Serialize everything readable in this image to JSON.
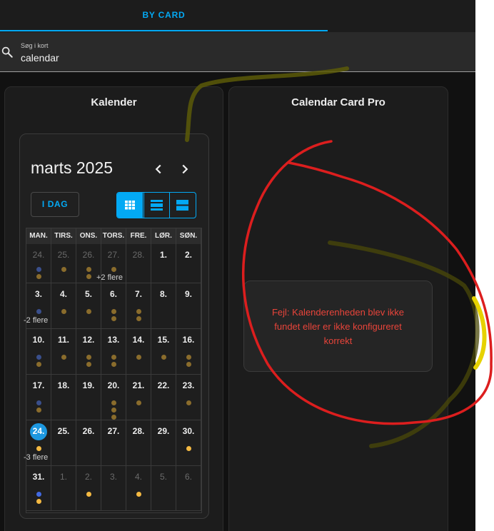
{
  "tabs": {
    "by_card": "BY CARD"
  },
  "search": {
    "label": "Søg i kort",
    "value": "calendar"
  },
  "cards": {
    "kalender": {
      "title": "Kalender",
      "month_title": "marts 2025",
      "today_label": "I DAG",
      "weekdays": [
        "MAN.",
        "TIRS.",
        "ONS.",
        "TORS.",
        "FRE.",
        "LØR.",
        "SØN."
      ],
      "weeks": [
        [
          {
            "day": "24.",
            "other": true,
            "dots": [
              "blue",
              "gold"
            ]
          },
          {
            "day": "25.",
            "other": true,
            "dots": [
              "gold"
            ]
          },
          {
            "day": "26.",
            "other": true,
            "dots": [
              "gold",
              "gold"
            ]
          },
          {
            "day": "27.",
            "other": true,
            "dots": [
              "gold"
            ],
            "more": "+2 flere"
          },
          {
            "day": "28.",
            "other": true,
            "dots": []
          },
          {
            "day": "1.",
            "dots": []
          },
          {
            "day": "2.",
            "dots": []
          }
        ],
        [
          {
            "day": "3.",
            "dots": [
              "blue"
            ],
            "more": "-2 flere"
          },
          {
            "day": "4.",
            "dots": [
              "gold"
            ]
          },
          {
            "day": "5.",
            "dots": [
              "gold"
            ]
          },
          {
            "day": "6.",
            "dots": [
              "gold",
              "gold"
            ]
          },
          {
            "day": "7.",
            "dots": [
              "gold",
              "gold"
            ]
          },
          {
            "day": "8.",
            "dots": []
          },
          {
            "day": "9.",
            "dots": []
          }
        ],
        [
          {
            "day": "10.",
            "dots": [
              "blue",
              "gold"
            ]
          },
          {
            "day": "11.",
            "dots": [
              "gold"
            ]
          },
          {
            "day": "12.",
            "dots": [
              "gold",
              "gold"
            ]
          },
          {
            "day": "13.",
            "dots": [
              "gold",
              "gold"
            ]
          },
          {
            "day": "14.",
            "dots": [
              "gold"
            ]
          },
          {
            "day": "15.",
            "dots": [
              "gold"
            ]
          },
          {
            "day": "16.",
            "dots": [
              "gold",
              "gold"
            ]
          }
        ],
        [
          {
            "day": "17.",
            "dots": [
              "blue",
              "gold"
            ]
          },
          {
            "day": "18.",
            "dots": []
          },
          {
            "day": "19.",
            "dots": []
          },
          {
            "day": "20.",
            "dots": [
              "gold",
              "gold",
              "gold"
            ]
          },
          {
            "day": "21.",
            "dots": [
              "gold"
            ]
          },
          {
            "day": "22.",
            "dots": []
          },
          {
            "day": "23.",
            "dots": [
              "gold"
            ]
          }
        ],
        [
          {
            "day": "24.",
            "today": true,
            "dots": [
              "yellow"
            ],
            "more": "-3 flere"
          },
          {
            "day": "25.",
            "dots": []
          },
          {
            "day": "26.",
            "dots": []
          },
          {
            "day": "27.",
            "dots": []
          },
          {
            "day": "28.",
            "dots": []
          },
          {
            "day": "29.",
            "dots": []
          },
          {
            "day": "30.",
            "dots": [
              "yellow"
            ]
          }
        ],
        [
          {
            "day": "31.",
            "dots": [
              "brightblue",
              "yellow"
            ]
          },
          {
            "day": "1.",
            "other": true,
            "dots": []
          },
          {
            "day": "2.",
            "other": true,
            "dots": [
              "yellow"
            ]
          },
          {
            "day": "3.",
            "other": true,
            "dots": []
          },
          {
            "day": "4.",
            "other": true,
            "dots": [
              "yellow"
            ]
          },
          {
            "day": "5.",
            "other": true,
            "dots": []
          },
          {
            "day": "6.",
            "other": true,
            "dots": []
          }
        ]
      ]
    },
    "pro": {
      "title": "Calendar Card Pro",
      "error": "Fejl: Kalenderenheden blev ikke fundet eller er ikke konfigureret korrekt"
    }
  },
  "colors": {
    "accent": "#03a9f4",
    "error": "#e8443a",
    "dot_blue": "#3a4f8c",
    "dot_gold": "#8a6c2c",
    "dot_yellow": "#f4b942",
    "dot_brightblue": "#4169e1"
  },
  "icons": {
    "search": "search-icon",
    "prev": "chevron-left-icon",
    "next": "chevron-right-icon",
    "month_view": "grid-view-icon",
    "week_view": "week-view-icon",
    "list_view": "list-view-icon"
  }
}
